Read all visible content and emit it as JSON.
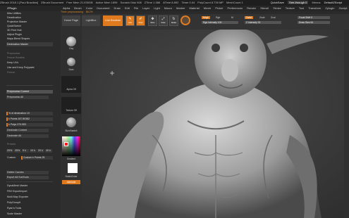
{
  "title_bar": {
    "left_items": [
      "ZBrush 2018.1 [Paul Brazilian]",
      "ZBrush Document",
      "Free Mem 21.035GB",
      "Active Mem 1899",
      "Scratch Disk 908",
      "ZTime 1.386",
      "ATime 8.892",
      "Timer 0.04",
      "PolyCount 8.739 MP",
      "MeshCount 1"
    ],
    "quicksave": "QuickSave",
    "see_through": "See-through 0",
    "menus_label": "Menus",
    "default_script": "DefaultZScript"
  },
  "menu_bar": {
    "app_name": "ZPlugin",
    "items": [
      "Alpha",
      "Brush",
      "Color",
      "Document",
      "Draw",
      "Edit",
      "File",
      "Layer",
      "Light",
      "Macro",
      "Marker",
      "Material",
      "Movie",
      "Picker",
      "Preferences",
      "Render",
      "Stencil",
      "Stroke",
      "Texture",
      "Tool",
      "Transform",
      "Zplugin",
      "Zscript",
      "Help"
    ]
  },
  "progress": {
    "label": "Timer preprocessing",
    "percent": "88.2%",
    "percent_value": 88.2
  },
  "left_panel": {
    "top_items": [
      "Misc Utilities",
      "Deactivation",
      "Projection Master",
      "QuickSketch",
      "3D Print Hub",
      "Adjust Plugin",
      "Maya Blend Shapes"
    ],
    "decimation_header": "Decimation Master",
    "dim_items": [
      "Preprocess",
      "Freeze Borders"
    ],
    "options": [
      "Keep UVs",
      "Use and Keep Polypaint",
      "Freeze"
    ],
    "preprocess_current": "Preprocess Current",
    "preprocess_all": "Preprocess All",
    "decimation_percent": "% of decimation 10",
    "k_points": "k Points 187.80382",
    "polys": "k Polys 373.953",
    "decimate_current": "Decimate Current",
    "decimate_all": "Decimate All",
    "presets_label": "Presets",
    "presets": [
      "20%",
      "25%",
      "5 k",
      "10 k",
      "20 k",
      "40 k"
    ],
    "custom_label": "Custom",
    "custom_value": "Custom k Points 25",
    "delete_caches": "Delete Caches",
    "export_all": "Export All SubTools",
    "bottom_items": [
      "DynaMesh Master",
      "FBX ExportImport",
      "Multi Map Exporter",
      "PolyGroupIt",
      "Ryan's Tools",
      "Scale Master"
    ]
  },
  "tool_strip": {
    "home_page": "Home Page",
    "lightbox": "LightBox",
    "live_boolean": "Live Boolean",
    "edit_label": "Edit",
    "draw_label": "Draw",
    "move_label": "Move",
    "scale_label": "Scale",
    "rotate_label": "Rotate",
    "brush_labels": [
      "Clay",
      "Dam"
    ],
    "alpha_off": "Alpha Off",
    "texture_off": "Texture Off",
    "matcap": "SkinShade4",
    "gradient_label": "Gradient",
    "switch_color": "SwitchColor",
    "alternate": "Alternate"
  },
  "sliders": {
    "mrgb": "Mrgb",
    "rgb": "Rgb",
    "m": "M",
    "zadd": "Zadd",
    "zsub": "Zsub",
    "zcut": "Zcut",
    "rgb_intensity": "Rgb Intensity 100",
    "z_intensity": "Z Intensity 32",
    "focal_shift": "Focal Shift 0",
    "draw_size": "Draw Size 64"
  },
  "colors": {
    "accent_orange": "#e07a1f",
    "panel_bg": "#2b2b2b",
    "viewport_bg": "#3c3c3c"
  }
}
